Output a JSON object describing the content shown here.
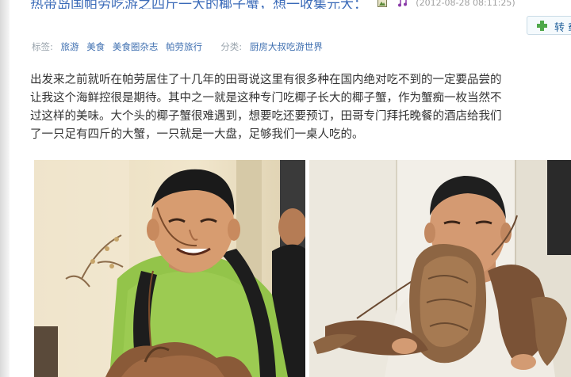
{
  "post": {
    "title": "热带岛国帕劳吃游之四斤一大的椰子蟹，想一收集元大：",
    "time": "(2012-08-28 08:11:25)"
  },
  "share": {
    "label": "转 载"
  },
  "meta": {
    "tags_label": "标签:",
    "tags": [
      "旅游",
      "美食",
      "美食圈杂志",
      "帕劳旅行"
    ],
    "category_label": "分类:",
    "category": "厨房大叔吃游世界"
  },
  "article": {
    "lines": [
      "出发来之前就听在帕劳居住了十几年的田哥说这里有很多种在国内绝对吃不到的一定要品尝的",
      "让我这个海鲜控很是期待。其中之一就是这种专门吃椰子长大的椰子蟹，作为蟹痴一枚当然不",
      "过这样的美味。大个头的椰子蟹很难遇到，想要吃还要预订，田哥专门拜托晚餐的酒店给我们",
      "了一只足有四斤的大蟹，一只就是一大盘，足够我们一桌人吃的。"
    ]
  },
  "icons": {
    "title_image": "image-icon",
    "title_music": "music-note-icon",
    "share": "plus-icon"
  },
  "colors": {
    "link": "#3f6fb0",
    "title": "#3a6ab8",
    "body_text": "#333333",
    "meta_label": "#9aa4ad",
    "share_plus": "#4ea84a"
  }
}
